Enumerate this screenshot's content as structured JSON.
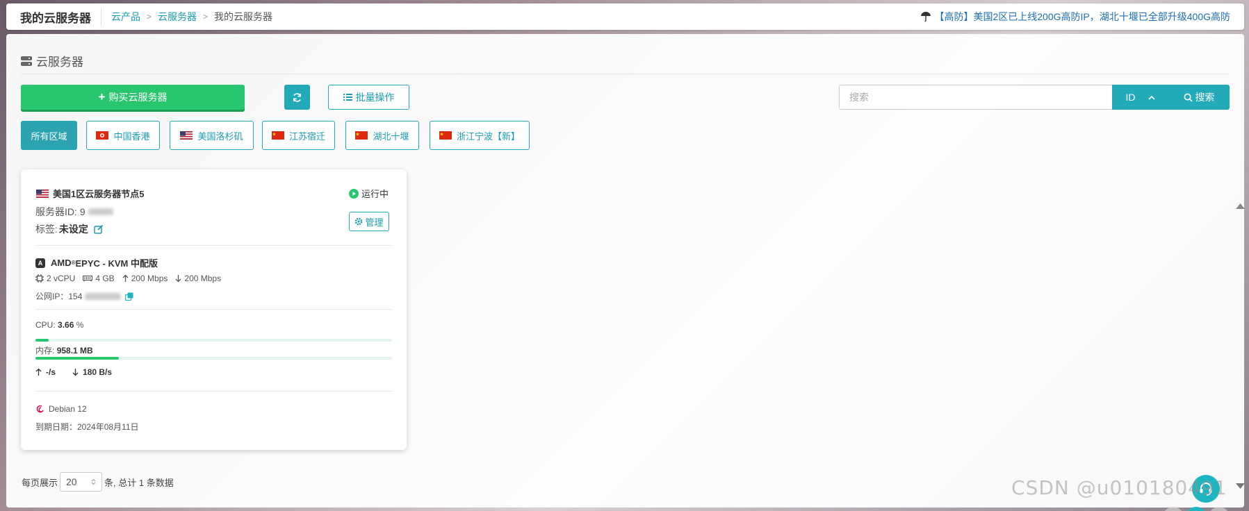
{
  "header": {
    "page_title": "我的云服务器",
    "breadcrumbs": [
      "云产品",
      "云服务器",
      "我的云服务器"
    ],
    "notice": "【高防】美国2区已上线200G高防IP，湖北十堰已全部升级400G高防"
  },
  "section": {
    "title": "云服务器"
  },
  "toolbar": {
    "buy_label": "购买云服务器",
    "batch_label": "批量操作",
    "search_placeholder": "搜索",
    "search_field": "ID",
    "search_label": "搜索"
  },
  "regions": [
    {
      "label": "所有区域",
      "active": true,
      "flag": ""
    },
    {
      "label": "中国香港",
      "active": false,
      "flag": "hk"
    },
    {
      "label": "美国洛杉矶",
      "active": false,
      "flag": "us"
    },
    {
      "label": "江苏宿迁",
      "active": false,
      "flag": "cn"
    },
    {
      "label": "湖北十堰",
      "active": false,
      "flag": "cn"
    },
    {
      "label": "浙江宁波【新】",
      "active": false,
      "flag": "cn"
    }
  ],
  "server": {
    "name": "美国1区云服务器节点5",
    "status": "运行中",
    "id_label": "服务器ID:",
    "id_value_prefix": "9",
    "tag_label": "标签:",
    "tag_value": "未设定",
    "manage_label": "管理",
    "plan_prefix": "AMD",
    "plan_sup": "®",
    "plan_suffix": " EPYC - KVM 中配版",
    "vcpu": "2 vCPU",
    "ram": "4 GB",
    "bw_up": "200 Mbps",
    "bw_down": "200 Mbps",
    "ip_label": "公网IP：",
    "ip_prefix": "154",
    "cpu_label": "CPU:",
    "cpu_value": "3.66",
    "cpu_unit": "%",
    "cpu_percent": 3.66,
    "mem_label": "内存:",
    "mem_value": "958.1 MB",
    "mem_fraction": 0.234,
    "net_up": "-/s",
    "net_down": "180 B/s",
    "os": "Debian 12",
    "expire": "到期日期：2024年08月11日"
  },
  "pager": {
    "prefix": "每页展示",
    "page_size": "20",
    "suffix": "条, 总计 1 条数据"
  },
  "watermark": "CSDN @u010180491",
  "colors": {
    "primary": "#22aab8",
    "success": "#28c76f",
    "notice": "#1a6fb5"
  }
}
